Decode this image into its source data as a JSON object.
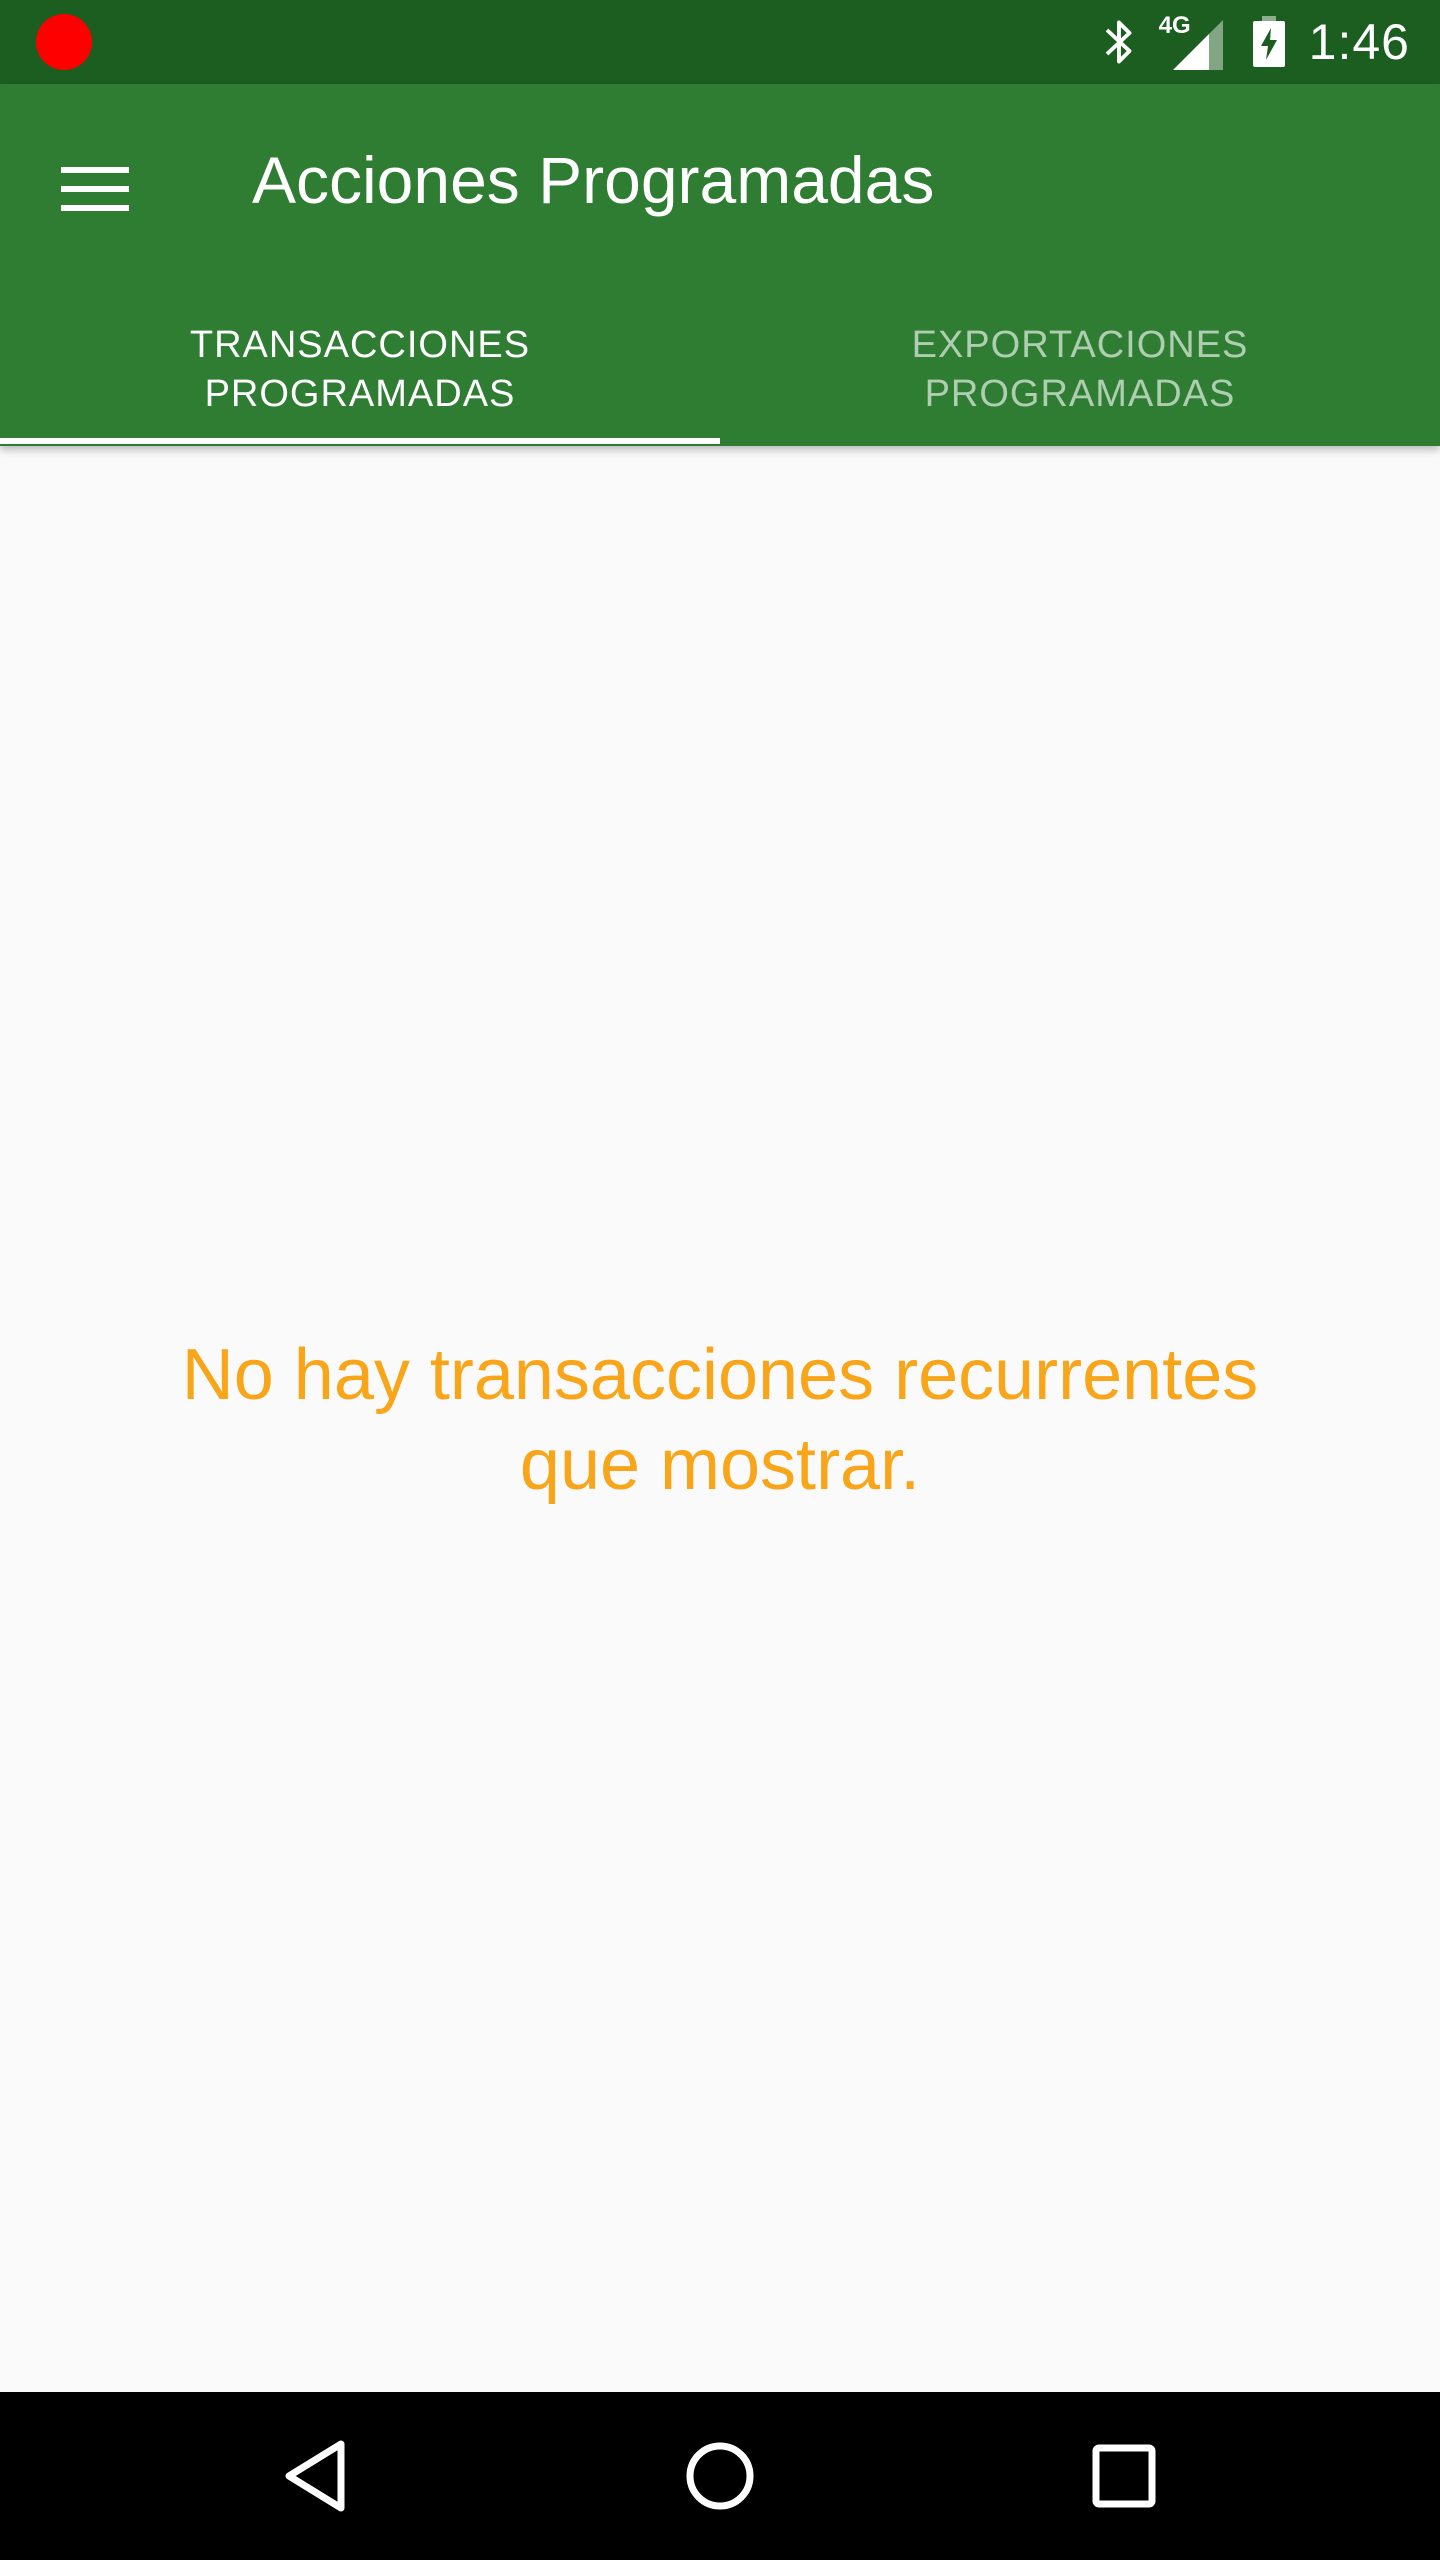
{
  "status_bar": {
    "time": "1:46",
    "network_label": "4G",
    "icons": [
      "record-indicator-icon",
      "bluetooth-icon",
      "cell-signal-4g-icon",
      "battery-charging-icon"
    ],
    "record_color": "#ff0000"
  },
  "app_bar": {
    "title": "Acciones Programadas",
    "menu_icon": "hamburger-menu-icon",
    "color": "#2e7d32",
    "status_color": "#1b5e20"
  },
  "tabs": [
    {
      "label": "TRANSACCIONES\nPROGRAMADAS",
      "active": true
    },
    {
      "label": "EXPORTACIONES\nPROGRAMADAS",
      "active": false
    }
  ],
  "main": {
    "empty_message": "No hay transacciones recurrentes\nque mostrar.",
    "message_color": "#f9a51a"
  },
  "nav_bar": {
    "buttons": [
      "back-icon",
      "home-icon",
      "recents-icon"
    ]
  }
}
